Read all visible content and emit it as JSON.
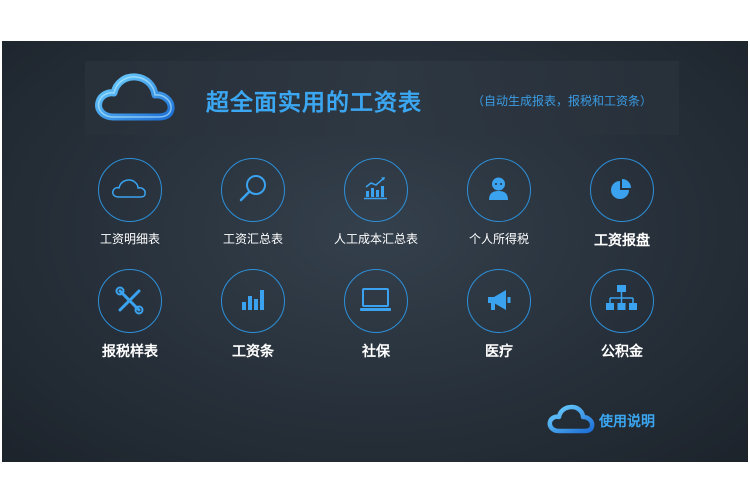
{
  "header": {
    "title": "超全面实用的工资表",
    "subtitle": "（自动生成报表，报税和工资条）"
  },
  "tiles_row1": [
    {
      "label": "工资明细表",
      "icon": "cloud-icon"
    },
    {
      "label": "工资汇总表",
      "icon": "search-icon"
    },
    {
      "label": "人工成本汇总表",
      "icon": "bar-chart-trend-icon"
    },
    {
      "label": "个人所得税",
      "icon": "user-icon"
    },
    {
      "label": "工资报盘",
      "icon": "pie-chart-icon"
    }
  ],
  "tiles_row2": [
    {
      "label": "报税样表",
      "icon": "tools-icon"
    },
    {
      "label": "工资条",
      "icon": "bar-chart-icon"
    },
    {
      "label": "社保",
      "icon": "monitor-icon"
    },
    {
      "label": "医疗",
      "icon": "megaphone-icon"
    },
    {
      "label": "公积金",
      "icon": "org-chart-icon"
    }
  ],
  "help": {
    "label": "使用说明"
  },
  "colors": {
    "accent": "#3ba7f2",
    "panel": "#27303a"
  }
}
